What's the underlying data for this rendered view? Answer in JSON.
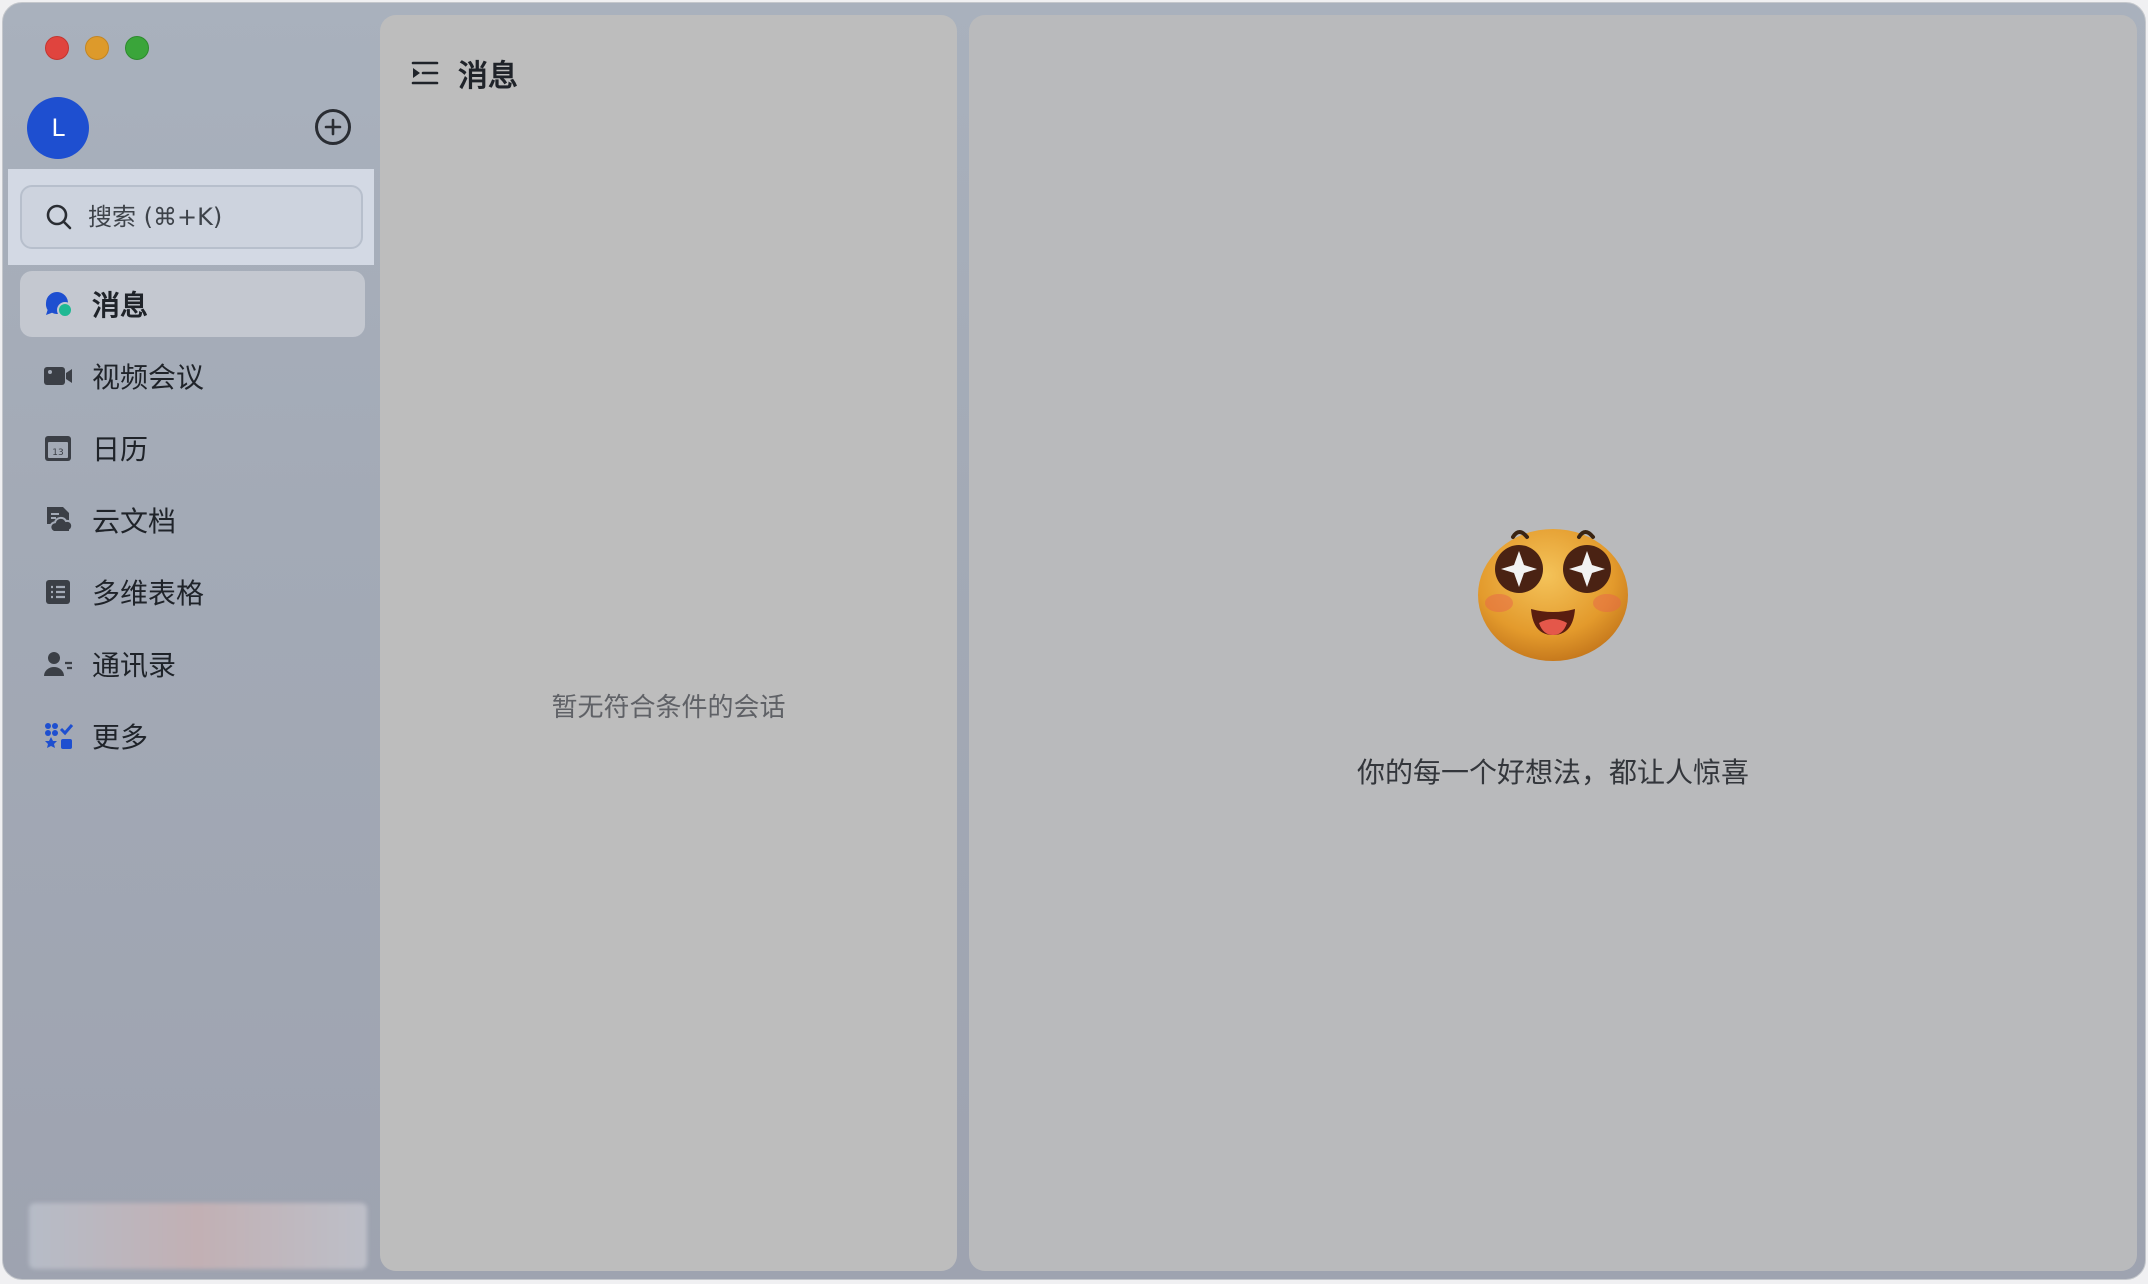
{
  "window": {
    "traffic_lights": [
      "close",
      "minimize",
      "maximize"
    ]
  },
  "sidebar": {
    "avatar_letter": "L",
    "search": {
      "placeholder": "搜索 (⌘+K)"
    },
    "items": [
      {
        "label": "消息",
        "icon": "message-icon",
        "active": true
      },
      {
        "label": "视频会议",
        "icon": "video-camera-icon",
        "active": false
      },
      {
        "label": "日历",
        "icon": "calendar-icon",
        "active": false
      },
      {
        "label": "云文档",
        "icon": "cloud-doc-icon",
        "active": false
      },
      {
        "label": "多维表格",
        "icon": "table-grid-icon",
        "active": false
      },
      {
        "label": "通讯录",
        "icon": "contacts-icon",
        "active": false
      },
      {
        "label": "更多",
        "icon": "apps-grid-icon",
        "active": false
      }
    ],
    "calendar_day": "13"
  },
  "list_panel": {
    "title": "消息",
    "empty_text": "暂无符合条件的会话"
  },
  "main_panel": {
    "welcome_text": "你的每一个好想法，都让人惊喜"
  },
  "colors": {
    "accent": "#1e4fd0",
    "message_icon_green": "#1fb893"
  }
}
